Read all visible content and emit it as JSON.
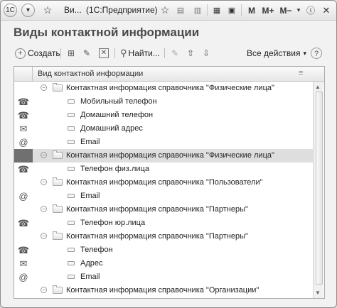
{
  "titlebar": {
    "title_short": "Ви...",
    "app_name": "(1С:Предприятие)",
    "m_label": "M",
    "m_plus_label": "M+",
    "m_minus_label": "M−"
  },
  "page": {
    "title": "Виды контактной информации"
  },
  "toolbar": {
    "create_label": "Создать",
    "find_label": "Найти...",
    "all_actions_label": "Все действия",
    "help_label": "?"
  },
  "grid": {
    "column_header": "Вид контактной информации",
    "rows": [
      {
        "text": "Контактная информация справочника \"Физические лица\"",
        "kind": "group",
        "icon": ""
      },
      {
        "text": "Мобильный телефон",
        "kind": "item",
        "icon": "☎"
      },
      {
        "text": "Домашний телефон",
        "kind": "item",
        "icon": "☎"
      },
      {
        "text": "Домашний адрес",
        "kind": "item",
        "icon": "✉"
      },
      {
        "text": "Email",
        "kind": "item",
        "icon": "@"
      },
      {
        "text": "Контактная информация справочника \"Физические лица\"",
        "kind": "group",
        "icon": ""
      },
      {
        "text": "Телефон физ.лица",
        "kind": "item",
        "icon": "☎"
      },
      {
        "text": "Контактная информация справочника \"Пользователи\"",
        "kind": "group",
        "icon": ""
      },
      {
        "text": "Email",
        "kind": "item",
        "icon": "@"
      },
      {
        "text": "Контактная информация справочника \"Партнеры\"",
        "kind": "group",
        "icon": ""
      },
      {
        "text": "Телефон юр.лица",
        "kind": "item",
        "icon": "☎"
      },
      {
        "text": "Контактная информация справочника \"Партнеры\"",
        "kind": "group",
        "icon": ""
      },
      {
        "text": "Телефон",
        "kind": "item",
        "icon": "☎"
      },
      {
        "text": "Адрес",
        "kind": "item",
        "icon": "✉"
      },
      {
        "text": "Email",
        "kind": "item",
        "icon": "@"
      },
      {
        "text": "Контактная информация справочника \"Организации\"",
        "kind": "group",
        "icon": ""
      }
    ]
  }
}
